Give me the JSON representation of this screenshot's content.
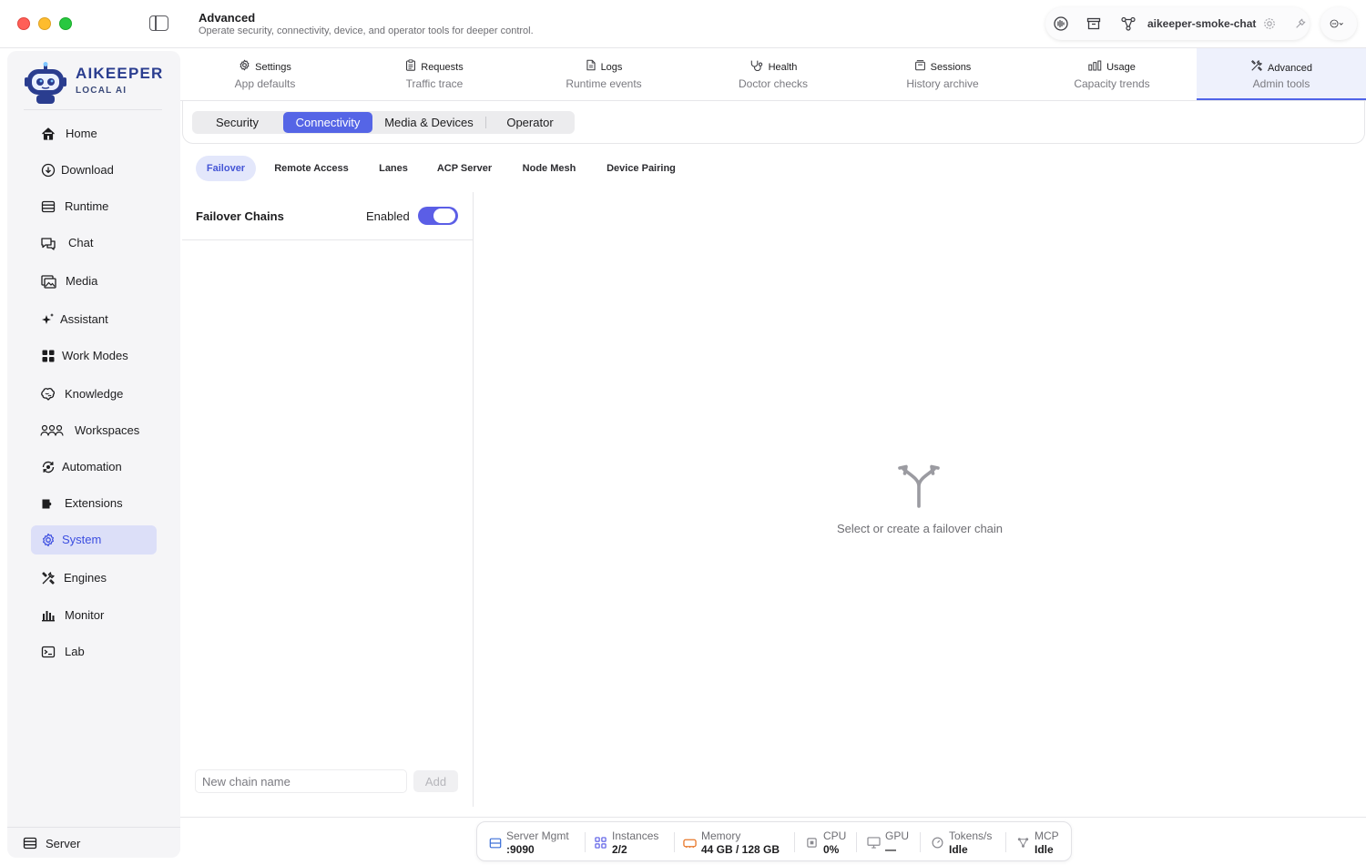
{
  "window": {
    "title": "Advanced",
    "subtitle": "Operate security, connectivity, device, and operator tools for deeper control."
  },
  "toolbar": {
    "project_name": "aikeeper-smoke-chat",
    "icons": [
      "waveform-icon",
      "archive-icon",
      "graph-icon",
      "gear-icon",
      "wrench-icon",
      "more-icon"
    ]
  },
  "brand": {
    "name": "AIKEEPER",
    "tagline": "LOCAL AI"
  },
  "sidebar": {
    "items": [
      {
        "label": "Home",
        "icon": "house-icon"
      },
      {
        "label": "Download",
        "icon": "download-icon"
      },
      {
        "label": "Runtime",
        "icon": "server-icon"
      },
      {
        "label": "Chat",
        "icon": "chat-icon"
      },
      {
        "label": "Media",
        "icon": "media-icon"
      },
      {
        "label": "Assistant",
        "icon": "sparkle-icon"
      },
      {
        "label": "Work Modes",
        "icon": "grid-icon"
      },
      {
        "label": "Knowledge",
        "icon": "brain-icon"
      },
      {
        "label": "Workspaces",
        "icon": "people-icon"
      },
      {
        "label": "Automation",
        "icon": "automation-icon"
      },
      {
        "label": "Extensions",
        "icon": "extension-icon"
      },
      {
        "label": "System",
        "icon": "gear-icon",
        "active": true
      },
      {
        "label": "Engines",
        "icon": "tools-icon"
      },
      {
        "label": "Monitor",
        "icon": "chart-icon"
      },
      {
        "label": "Lab",
        "icon": "terminal-icon"
      }
    ],
    "footer": {
      "label": "Server",
      "icon": "server-icon"
    }
  },
  "main_tabs": [
    {
      "label": "Settings",
      "sub": "App defaults",
      "icon": "gear-icon"
    },
    {
      "label": "Requests",
      "sub": "Traffic trace",
      "icon": "clipboard-icon"
    },
    {
      "label": "Logs",
      "sub": "Runtime events",
      "icon": "document-icon"
    },
    {
      "label": "Health",
      "sub": "Doctor checks",
      "icon": "stethoscope-icon"
    },
    {
      "label": "Sessions",
      "sub": "History archive",
      "icon": "sessions-icon"
    },
    {
      "label": "Usage",
      "sub": "Capacity trends",
      "icon": "bar-chart-icon"
    },
    {
      "label": "Advanced",
      "sub": "Admin tools",
      "icon": "tools-icon",
      "active": true
    }
  ],
  "segments": [
    {
      "label": "Security"
    },
    {
      "label": "Connectivity",
      "active": true
    },
    {
      "label": "Media & Devices"
    },
    {
      "label": "Operator"
    }
  ],
  "subtabs": [
    {
      "label": "Failover",
      "active": true
    },
    {
      "label": "Remote Access"
    },
    {
      "label": "Lanes"
    },
    {
      "label": "ACP Server"
    },
    {
      "label": "Node Mesh"
    },
    {
      "label": "Device Pairing"
    }
  ],
  "failover": {
    "title": "Failover Chains",
    "enabled_label": "Enabled",
    "enabled": true,
    "input_placeholder": "New chain name",
    "input_value": "",
    "add_label": "Add",
    "empty_text": "Select or create a failover chain"
  },
  "status_bar": [
    {
      "label": "Server Mgmt",
      "value": ":9090",
      "icon": "server-icon",
      "color": "#3b6fd8"
    },
    {
      "label": "Instances",
      "value": "2/2",
      "icon": "grid-icon",
      "color": "#5b5ee6"
    },
    {
      "label": "Memory",
      "value": "44 GB / 128 GB",
      "icon": "memory-icon",
      "color": "#e8782a"
    },
    {
      "label": "CPU",
      "value": "0%",
      "icon": "cpu-icon",
      "color": "#8a8a90"
    },
    {
      "label": "GPU",
      "value": "—",
      "icon": "monitor-icon",
      "color": "#8a8a90"
    },
    {
      "label": "Tokens/s",
      "value": "Idle",
      "icon": "gauge-icon",
      "color": "#8a8a90"
    },
    {
      "label": "MCP",
      "value": "Idle",
      "icon": "graph-icon",
      "color": "#8a8a90"
    }
  ],
  "colors": {
    "accent": "#5565e6",
    "active_nav_bg": "#dcdff8",
    "brand": "#2a3d8f"
  }
}
